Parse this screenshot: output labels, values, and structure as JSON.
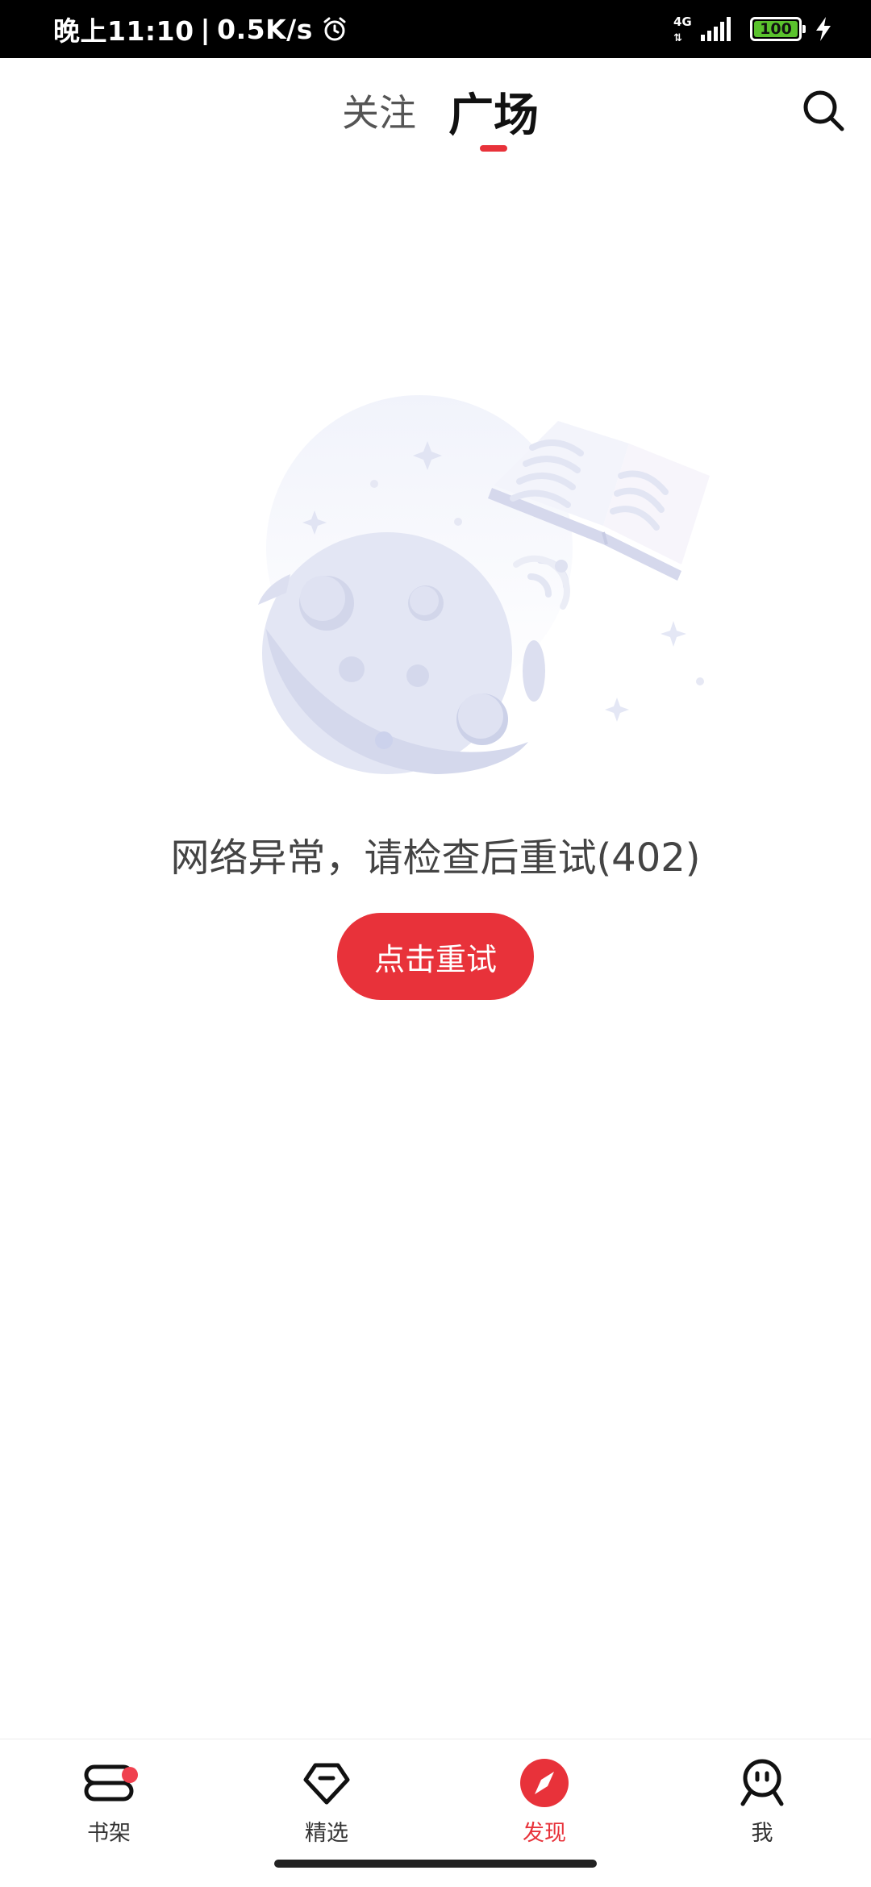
{
  "status_bar": {
    "time": "晚上11:10",
    "separator": "|",
    "speed": "0.5K/s",
    "network_type": "4G",
    "network_arrows": "⇅",
    "battery": "100",
    "icons": [
      "alarm-icon",
      "signal-icon",
      "battery-icon",
      "charging-icon"
    ]
  },
  "top_tabs": {
    "follow_label": "关注",
    "plaza_label": "广场",
    "active": "广场",
    "search_icon": "search-icon"
  },
  "empty_state": {
    "illustration": "moon-with-book-illustration",
    "message": "网络异常，请检查后重试(402)",
    "retry_label": "点击重试"
  },
  "bottom_nav": {
    "items": [
      {
        "label": "书架",
        "icon": "bookshelf-icon",
        "has_badge": true
      },
      {
        "label": "精选",
        "icon": "diamond-icon"
      },
      {
        "label": "发现",
        "icon": "compass-icon",
        "active": true
      },
      {
        "label": "我",
        "icon": "profile-face-icon"
      }
    ]
  },
  "colors": {
    "accent": "#e8323a",
    "badge": "#f0414f",
    "battery_green": "#5ac22d"
  }
}
